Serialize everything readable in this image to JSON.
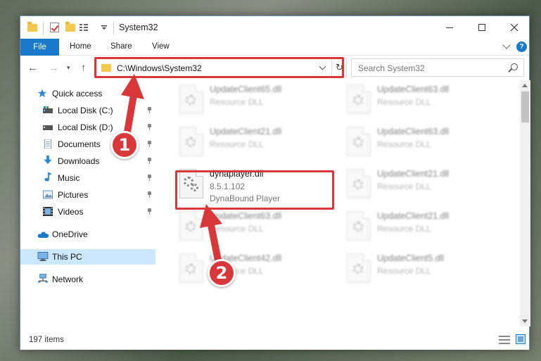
{
  "window": {
    "title": "System32"
  },
  "ribbon": {
    "tabs": [
      "File",
      "Home",
      "Share",
      "View"
    ]
  },
  "address": {
    "path": "C:\\Windows\\System32"
  },
  "search": {
    "placeholder": "Search System32"
  },
  "sidebar": {
    "items": [
      {
        "label": "Quick access",
        "icon": "star-icon"
      },
      {
        "label": "Local Disk (C:)",
        "icon": "drive-icon",
        "pinned": true
      },
      {
        "label": "Local Disk (D:)",
        "icon": "drive-icon",
        "pinned": true
      },
      {
        "label": "Documents",
        "icon": "documents-icon",
        "pinned": true
      },
      {
        "label": "Downloads",
        "icon": "downloads-icon",
        "pinned": true
      },
      {
        "label": "Music",
        "icon": "music-icon",
        "pinned": true
      },
      {
        "label": "Pictures",
        "icon": "pictures-icon",
        "pinned": true
      },
      {
        "label": "Videos",
        "icon": "videos-icon",
        "pinned": true
      },
      {
        "label": "OneDrive",
        "icon": "cloud-icon"
      },
      {
        "label": "This PC",
        "icon": "computer-icon",
        "selected": true
      },
      {
        "label": "Network",
        "icon": "network-icon"
      }
    ]
  },
  "files": [
    {
      "name": "UpdateClient65.dll",
      "line2": "Resource DLL",
      "blurred": true
    },
    {
      "name": "UpdateClient63.dll",
      "line2": "Resource DLL",
      "blurred": true
    },
    {
      "name": "UpdateClient21.dll",
      "line2": "Resource DLL",
      "blurred": true
    },
    {
      "name": "UpdateClient63.dll",
      "line2": "Resource DLL",
      "blurred": true
    },
    {
      "name": "dynaplayer.dll",
      "line2": "8.5.1.102",
      "line3": "DynaBound Player",
      "blurred": false
    },
    {
      "name": "UpdateClient21.dll",
      "line2": "Resource DLL",
      "blurred": true
    },
    {
      "name": "UpdateClient63.dll",
      "line2": "Resource DLL",
      "blurred": true
    },
    {
      "name": "UpdateClient21.dll",
      "line2": "Resource DLL",
      "blurred": true
    },
    {
      "name": "UpdateClient42.dll",
      "line2": "Resource DLL",
      "blurred": true
    },
    {
      "name": "UpdateClient5.dll",
      "line2": "Resource DLL",
      "blurred": true
    }
  ],
  "status": {
    "item_count": "197 items"
  },
  "callouts": {
    "one": "1",
    "two": "2"
  },
  "colors": {
    "accent": "#1979ca",
    "highlight": "#d9383a",
    "selected_bg": "#cce8ff"
  }
}
